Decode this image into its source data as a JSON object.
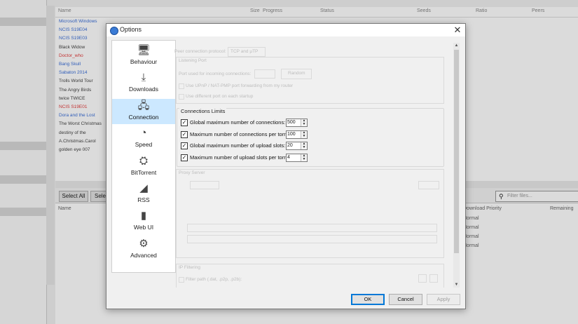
{
  "background": {
    "list_header": [
      "Name",
      "Size",
      "Progress",
      "Status",
      "Seeds",
      "Ratio",
      "Peers"
    ],
    "rows": [
      {
        "name": "Microsoft Windows",
        "color": "#3b6fd8"
      },
      {
        "name": "NCIS S19E04",
        "color": "#3b6fd8"
      },
      {
        "name": "NCIS S19E03",
        "color": "#3b6fd8"
      },
      {
        "name": "Black Widow",
        "color": "#444444"
      },
      {
        "name": "Doctor_who",
        "color": "#e23b3b"
      },
      {
        "name": "Bang Skull",
        "color": "#3b6fd8"
      },
      {
        "name": "Sabaton 2014",
        "color": "#3b6fd8"
      },
      {
        "name": "Trolls World Tour",
        "color": "#444444"
      },
      {
        "name": "The Angry Birds",
        "color": "#444444"
      },
      {
        "name": "twice TWICE",
        "color": "#444444"
      },
      {
        "name": "NCIS S19E01",
        "color": "#e23b3b"
      },
      {
        "name": "Dora and the Lost",
        "color": "#3b6fd8"
      },
      {
        "name": "The Worst Christmas",
        "color": "#444444"
      },
      {
        "name": "destiny of the",
        "color": "#444444"
      },
      {
        "name": "A.Christmas.Carol",
        "color": "#444444"
      },
      {
        "name": "golden eye 007",
        "color": "#444444"
      }
    ],
    "select_all_label": "Select All",
    "select_none_label": "Selec",
    "search_placeholder": "Filter files...",
    "files_header": [
      "Name",
      "Download Priority",
      "Remaining"
    ],
    "priority_values": [
      "Normal",
      "Normal",
      "Normal",
      "Normal"
    ]
  },
  "dialog": {
    "title": "Options",
    "close_glyph": "✕",
    "nav": [
      {
        "label": "Behaviour",
        "icon": "🖥",
        "selected": false
      },
      {
        "label": "Downloads",
        "icon": "⤓",
        "selected": false
      },
      {
        "label": "Connection",
        "icon": "🖧",
        "selected": true
      },
      {
        "label": "Speed",
        "icon": "◔",
        "selected": false
      },
      {
        "label": "BitTorrent",
        "icon": "⛭",
        "selected": false
      },
      {
        "label": "RSS",
        "icon": "◢",
        "selected": false
      },
      {
        "label": "Web UI",
        "icon": "▮",
        "selected": false
      },
      {
        "label": "Advanced",
        "icon": "⚙",
        "selected": false
      }
    ],
    "ghost": {
      "protocol_label": "Peer connection protocol:",
      "protocol_value": "TCP and μTP",
      "listening_port": "Listening Port",
      "port_label": "Port used for incoming connections:",
      "random_button": "Random",
      "upnp": "Use UPnP / NAT-PMP port forwarding from my router",
      "diff_port": "Use different port on each startup",
      "proxy_title": "Proxy Server",
      "ip_filtering": "IP Filtering",
      "filter_path": "Filter path (.dat, .p2p, .p2b):"
    },
    "connection_limits": {
      "title": "Connections Limits",
      "options": [
        {
          "label": "Global maximum number of connections:",
          "value": "500",
          "checked": true
        },
        {
          "label": "Maximum number of connections per torrent:",
          "value": "100",
          "checked": true
        },
        {
          "label": "Global maximum number of upload slots:",
          "value": "20",
          "checked": true
        },
        {
          "label": "Maximum number of upload slots per torrent:",
          "value": "4",
          "checked": true
        }
      ]
    },
    "buttons": {
      "ok": "OK",
      "cancel": "Cancel",
      "apply": "Apply"
    }
  }
}
